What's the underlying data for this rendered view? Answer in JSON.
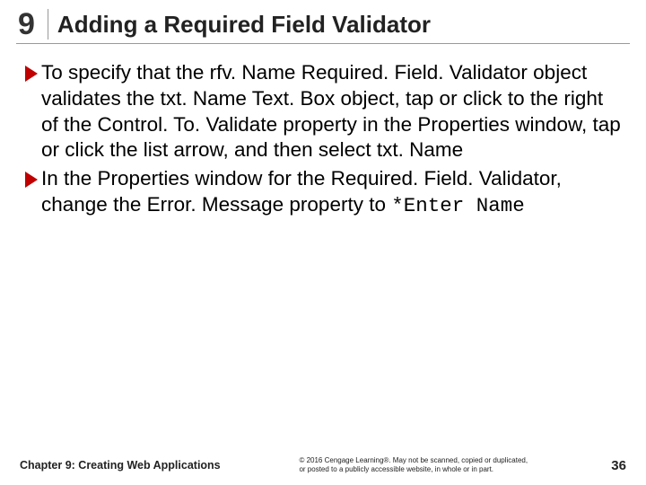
{
  "header": {
    "chapter_number": "9",
    "title": "Adding a Required Field Validator"
  },
  "bullets": [
    {
      "text_pre": "To specify that the rfv. Name Required. Field. Validator object validates the txt. Name Text. Box object, tap or click to the right of the Control. To. Validate property in the Properties window, tap or click the list arrow, and then select txt. Name",
      "text_mono": "",
      "text_post": ""
    },
    {
      "text_pre": "In the Properties window for the Required. Field. Validator, change the Error. Message property to ",
      "text_mono": "*Enter Name",
      "text_post": ""
    }
  ],
  "footer": {
    "left": "Chapter 9: Creating Web Applications",
    "center": "© 2016 Cengage Learning®. May not be scanned, copied or duplicated, or posted to a publicly accessible website, in whole or in part.",
    "page": "36"
  }
}
